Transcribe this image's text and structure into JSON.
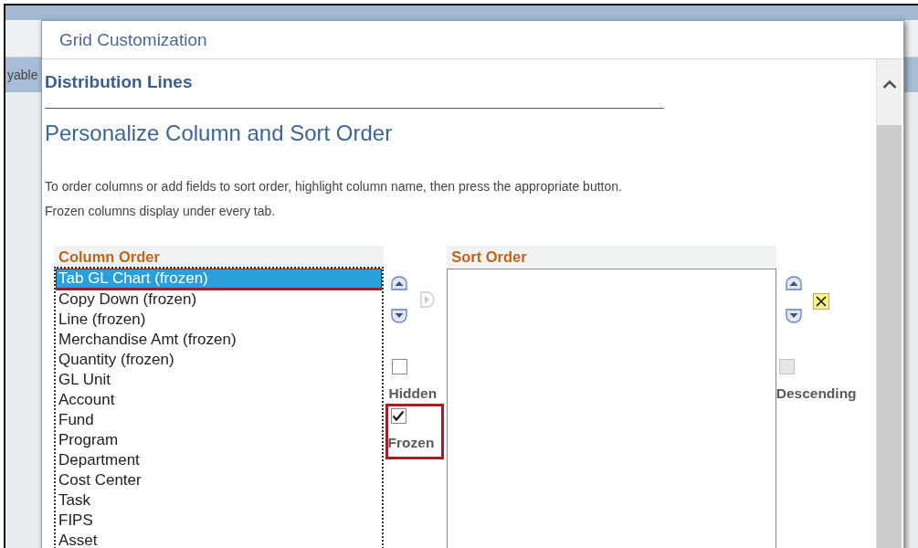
{
  "background": {
    "tab_text": "yable"
  },
  "dialog": {
    "title": "Grid Customization",
    "section": "Distribution Lines",
    "heading": "Personalize Column and Sort Order",
    "instructions": [
      "To order columns or add fields to sort order, highlight column name, then press the appropriate button.",
      "Frozen columns display under every tab."
    ],
    "column_order": {
      "title": "Column Order",
      "items": [
        {
          "label": "Tab GL Chart (frozen)",
          "selected": true,
          "highlighted": true
        },
        {
          "label": "Copy Down (frozen)",
          "selected": false,
          "highlighted": false
        },
        {
          "label": "Line (frozen)",
          "selected": false,
          "highlighted": false
        },
        {
          "label": "Merchandise Amt (frozen)",
          "selected": false,
          "highlighted": false
        },
        {
          "label": "Quantity (frozen)",
          "selected": false,
          "highlighted": false
        },
        {
          "label": "GL Unit",
          "selected": false,
          "highlighted": false
        },
        {
          "label": "Account",
          "selected": false,
          "highlighted": false
        },
        {
          "label": "Fund",
          "selected": false,
          "highlighted": false
        },
        {
          "label": "Program",
          "selected": false,
          "highlighted": false
        },
        {
          "label": "Department",
          "selected": false,
          "highlighted": false
        },
        {
          "label": "Cost Center",
          "selected": false,
          "highlighted": false
        },
        {
          "label": "Task",
          "selected": false,
          "highlighted": false
        },
        {
          "label": "FIPS",
          "selected": false,
          "highlighted": false
        },
        {
          "label": "Asset",
          "selected": false,
          "highlighted": false
        }
      ]
    },
    "add_to_sort": {
      "disabled": true
    },
    "column_options": [
      {
        "label": "Hidden",
        "checked": false,
        "highlighted": false
      },
      {
        "label": "Frozen",
        "checked": true,
        "highlighted": true
      }
    ],
    "sort_order": {
      "title": "Sort Order",
      "descending": {
        "label": "Descending",
        "checked": false,
        "disabled": true
      }
    }
  }
}
